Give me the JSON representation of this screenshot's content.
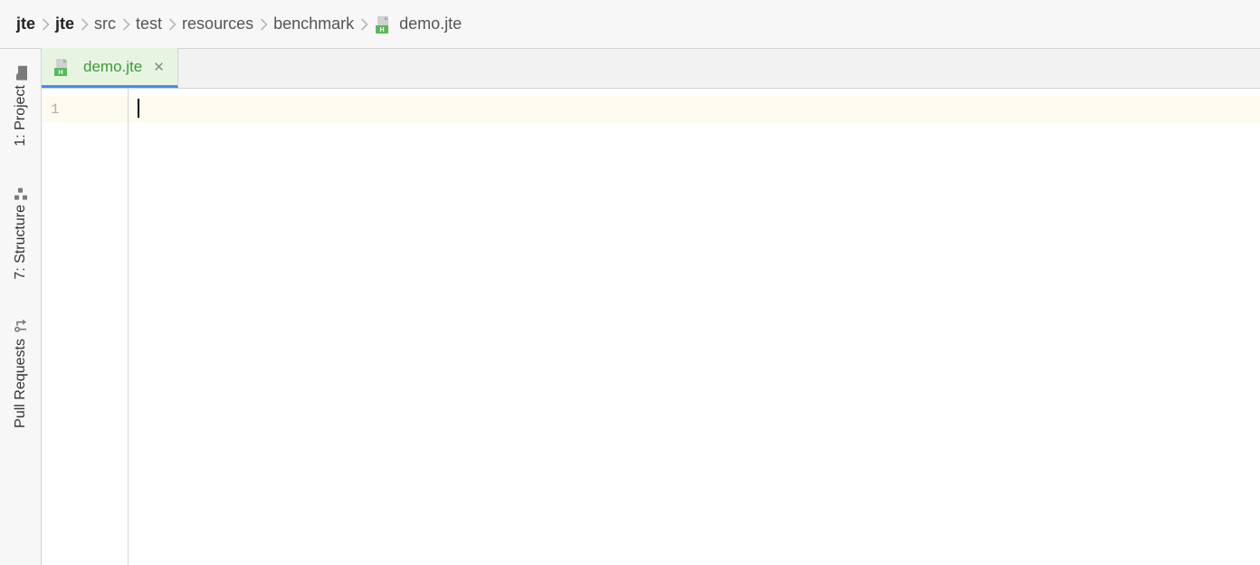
{
  "breadcrumb": {
    "segments": [
      "jte",
      "jte",
      "src",
      "test",
      "resources",
      "benchmark",
      "demo.jte"
    ],
    "bold_indices": [
      0,
      1
    ]
  },
  "sidebar": {
    "tools": [
      {
        "label": "1: Project"
      },
      {
        "label": "7: Structure"
      },
      {
        "label": "Pull Requests"
      }
    ]
  },
  "tabs": [
    {
      "label": "demo.jte",
      "active": true
    }
  ],
  "editor": {
    "line_numbers": [
      "1"
    ],
    "lines": [
      ""
    ]
  }
}
